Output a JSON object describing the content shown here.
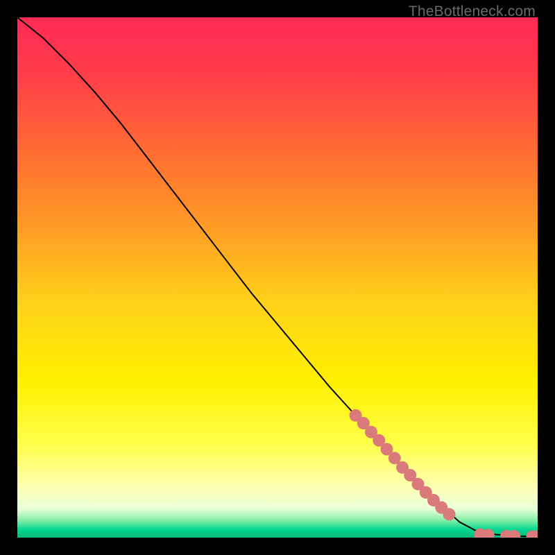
{
  "watermark": "TheBottleneck.com",
  "colors": {
    "marker": "#da7a7a",
    "line": "#000000",
    "background": "#000000",
    "gradient_stops": [
      {
        "offset": 0,
        "color": "#ff2a55"
      },
      {
        "offset": 0.1,
        "color": "#ff3a4a"
      },
      {
        "offset": 0.25,
        "color": "#ff6a34"
      },
      {
        "offset": 0.4,
        "color": "#ff9a25"
      },
      {
        "offset": 0.55,
        "color": "#ffd21a"
      },
      {
        "offset": 0.7,
        "color": "#fff000"
      },
      {
        "offset": 0.82,
        "color": "#ffff4a"
      },
      {
        "offset": 0.9,
        "color": "#ffffb0"
      },
      {
        "offset": 0.945,
        "color": "#e8ffd8"
      },
      {
        "offset": 0.965,
        "color": "#8ff0aa"
      },
      {
        "offset": 0.985,
        "color": "#00d68f"
      },
      {
        "offset": 1.0,
        "color": "#00b877"
      }
    ]
  },
  "chart_data": {
    "type": "line",
    "title": "",
    "xlabel": "",
    "ylabel": "",
    "xlim": [
      0,
      100
    ],
    "ylim": [
      0,
      100
    ],
    "series": [
      {
        "name": "curve",
        "x": [
          0,
          5,
          10,
          15,
          20,
          25,
          30,
          35,
          40,
          45,
          50,
          55,
          60,
          65,
          70,
          75,
          80,
          85,
          88,
          92,
          96,
          100
        ],
        "y": [
          100,
          96,
          91,
          85.5,
          79.5,
          73,
          66.5,
          60,
          53.5,
          47,
          41,
          35,
          29,
          23.5,
          18,
          12.5,
          7.5,
          3.0,
          1.4,
          0.6,
          0.3,
          0.2
        ]
      }
    ],
    "markers": [
      {
        "name": "segment-cluster",
        "points": [
          {
            "x": 65.0,
            "y": 23.5
          },
          {
            "x": 66.5,
            "y": 22.0
          },
          {
            "x": 68.0,
            "y": 20.3
          },
          {
            "x": 69.5,
            "y": 18.7
          },
          {
            "x": 71.0,
            "y": 17.0
          },
          {
            "x": 72.5,
            "y": 15.3
          },
          {
            "x": 74.0,
            "y": 13.5
          },
          {
            "x": 75.5,
            "y": 12.0
          },
          {
            "x": 77.0,
            "y": 10.3
          },
          {
            "x": 78.5,
            "y": 8.7
          },
          {
            "x": 80.0,
            "y": 7.2
          },
          {
            "x": 81.5,
            "y": 5.8
          },
          {
            "x": 83.0,
            "y": 4.5
          }
        ]
      },
      {
        "name": "tail-cluster",
        "points": [
          {
            "x": 89.0,
            "y": 0.6
          },
          {
            "x": 90.5,
            "y": 0.5
          },
          {
            "x": 94.0,
            "y": 0.3
          },
          {
            "x": 95.5,
            "y": 0.3
          },
          {
            "x": 99.0,
            "y": 0.2
          },
          {
            "x": 100.0,
            "y": 0.2
          }
        ]
      }
    ]
  }
}
